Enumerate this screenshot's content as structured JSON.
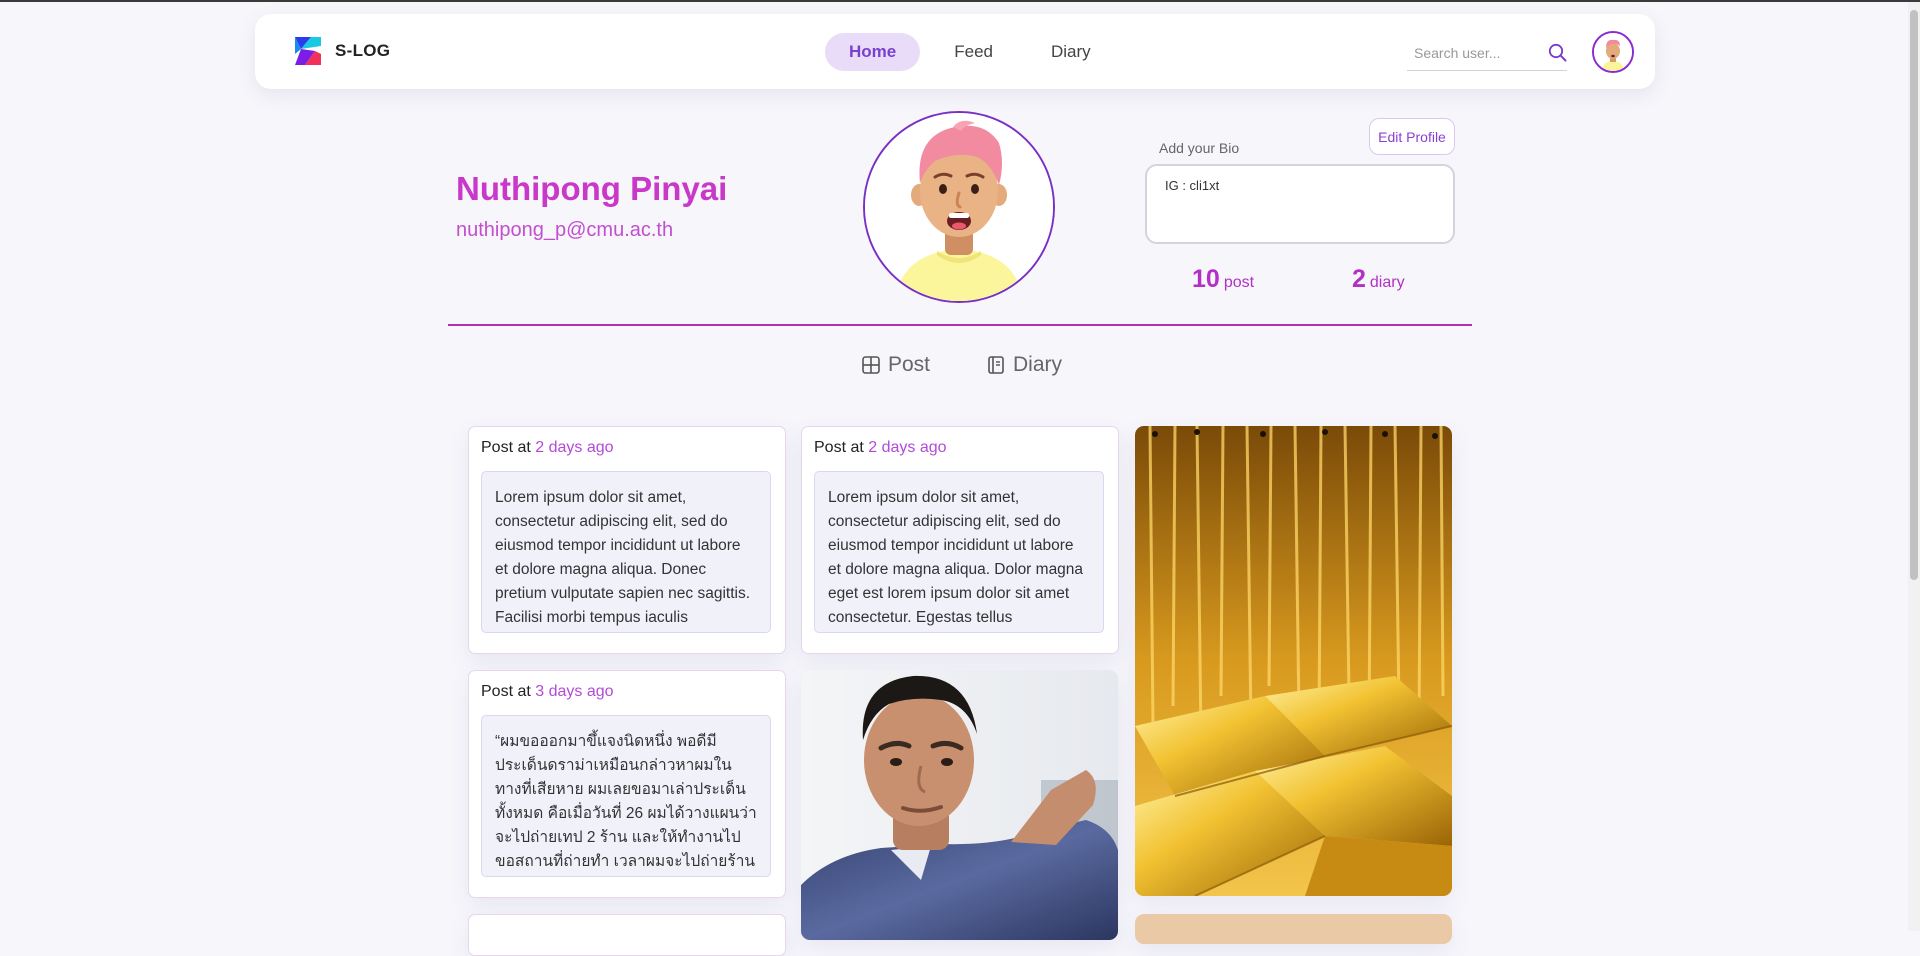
{
  "nav": {
    "brand": "S-LOG",
    "links": [
      "Home",
      "Feed",
      "Diary"
    ],
    "active": "Home",
    "search_placeholder": "Search user..."
  },
  "profile": {
    "name": "Nuthipong Pinyai",
    "email": "nuthipong_p@cmu.ac.th",
    "edit_label": "Edit Profile",
    "bio_label": "Add your Bio",
    "bio": "IG : cli1xt",
    "post_count": "10",
    "post_label": "post",
    "diary_count": "2",
    "diary_label": "diary"
  },
  "tabs": {
    "post": "Post",
    "diary": "Diary"
  },
  "posts": [
    {
      "prefix": "Post at",
      "time": "2 days ago",
      "text": "Lorem ipsum dolor sit amet, consectetur adipiscing elit, sed do eiusmod tempor incididunt ut labore et dolore magna aliqua. Donec pretium vulputate sapien nec sagittis. Facilisi morbi tempus iaculis"
    },
    {
      "prefix": "Post at",
      "time": "2 days ago",
      "text": "Lorem ipsum dolor sit amet, consectetur adipiscing elit, sed do eiusmod tempor incididunt ut labore et dolore magna aliqua. Dolor magna eget est lorem ipsum dolor sit amet consectetur. Egestas tellus"
    },
    {
      "prefix": "Post at",
      "time": "3 days ago",
      "text": "“ผมขอออกมาขึ้แจงนิดหนึ่ง พอดีมีประเด็นดราม่าเหมือนกล่าวหาผมในทางที่เสียหาย ผมเลยขอมาเล่าประเด็นทั้งหมด คือเมื่อวันที่ 26 ผมได้วางแผนว่าจะไปถ่ายเทป 2 ร้าน และให้ทำงานไปขอสถานที่ถ่ายทำ เวลาผมจะไปถ่ายร้านไหน"
    }
  ],
  "colors": {
    "accent": "#c938c9",
    "nav_active_bg": "#e9dcf8",
    "divider": "#b12fb8"
  }
}
